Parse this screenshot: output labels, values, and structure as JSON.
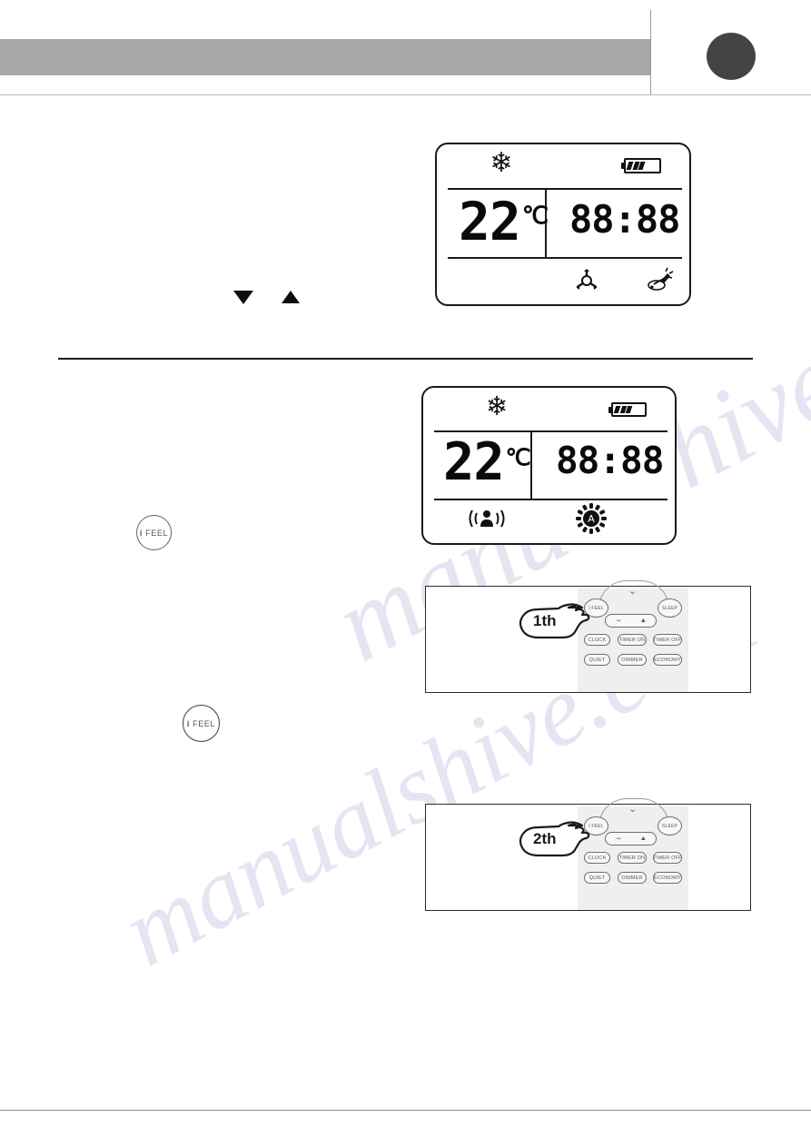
{
  "page": {
    "number_badge": "",
    "background": "#ffffff"
  },
  "header": {
    "bar_color": "#a8a8a8",
    "divider_color": "#b9b9b9",
    "page_dot_color": "#444444"
  },
  "watermark": {
    "line1": "manualshive.com",
    "line2": "manualshive.com"
  },
  "displays": [
    {
      "id": "display-cool-fan",
      "mode_icon": "snowflake-icon",
      "battery_icon": "battery-icon",
      "battery_bars": 3,
      "temperature": "22",
      "unit": "℃",
      "clock": "88:88",
      "bottom_icons": [
        {
          "name": "fan-speed-icon",
          "label": "fan"
        },
        {
          "name": "health-clean-icon",
          "label": "clean"
        }
      ]
    },
    {
      "id": "display-ifeel-auto",
      "mode_icon": "snowflake-icon",
      "battery_icon": "battery-icon",
      "battery_bars": 3,
      "temperature": "22",
      "unit": "℃",
      "clock": "88:88",
      "bottom_icons": [
        {
          "name": "ifeel-person-signal-icon",
          "label": "i feel"
        },
        {
          "name": "auto-fan-icon",
          "label": "A"
        }
      ]
    }
  ],
  "arrows": {
    "down": "▽",
    "up": "△"
  },
  "ifeel_buttons": [
    {
      "id": "ifeel-button-1",
      "prefix": "i",
      "label": "FEEL"
    },
    {
      "id": "ifeel-button-2",
      "prefix": "i",
      "label": "FEEL"
    }
  ],
  "remote_figures": [
    {
      "id": "remote-figure-first-press",
      "step_label": "1th",
      "chevron": "⌄",
      "buttons": {
        "ifeel": "I FEEL",
        "sleep": "SLEEP",
        "clock": "CLOCK",
        "timer_on": "TIMER ON",
        "timer_off": "TIMER OFF",
        "quiet": "QUIET",
        "dimmer": "DIMMER",
        "economy": "ECONOMY"
      },
      "pill_icons": [
        {
          "name": "swing-horizontal-icon",
          "glyph": "⇝"
        },
        {
          "name": "swing-vertical-icon",
          "glyph": "⛰"
        }
      ]
    },
    {
      "id": "remote-figure-second-press",
      "step_label": "2th",
      "chevron": "⌄",
      "buttons": {
        "ifeel": "I FEEL",
        "sleep": "SLEEP",
        "clock": "CLOCK",
        "timer_on": "TIMER ON",
        "timer_off": "TIMER OFF",
        "quiet": "QUIET",
        "dimmer": "DIMMER",
        "economy": "ECONOMY"
      },
      "pill_icons": [
        {
          "name": "swing-horizontal-icon",
          "glyph": "⇝"
        },
        {
          "name": "swing-vertical-icon",
          "glyph": "⛰"
        }
      ]
    }
  ]
}
